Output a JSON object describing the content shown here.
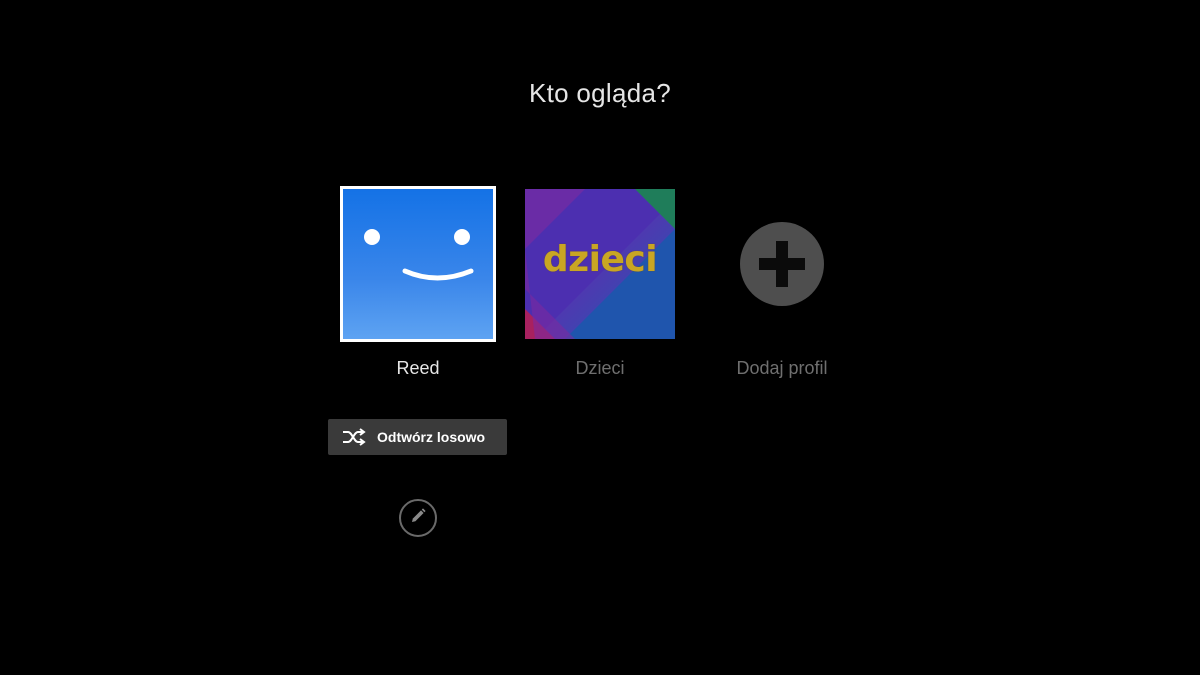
{
  "title": "Kto ogląda?",
  "profiles": [
    {
      "name": "Reed",
      "avatar": "smiley-face-icon",
      "color": "#1472e6",
      "selected": true
    },
    {
      "name": "Dzieci",
      "avatar_text": "dzieci",
      "avatar": "kids-avatar",
      "selected": false
    },
    {
      "name": "Dodaj profil",
      "avatar": "plus-circle-icon",
      "selected": false
    }
  ],
  "shuffle_button": {
    "label": "Odtwórz losowo",
    "icon": "shuffle-icon"
  },
  "edit_button": {
    "icon": "pencil-icon"
  }
}
